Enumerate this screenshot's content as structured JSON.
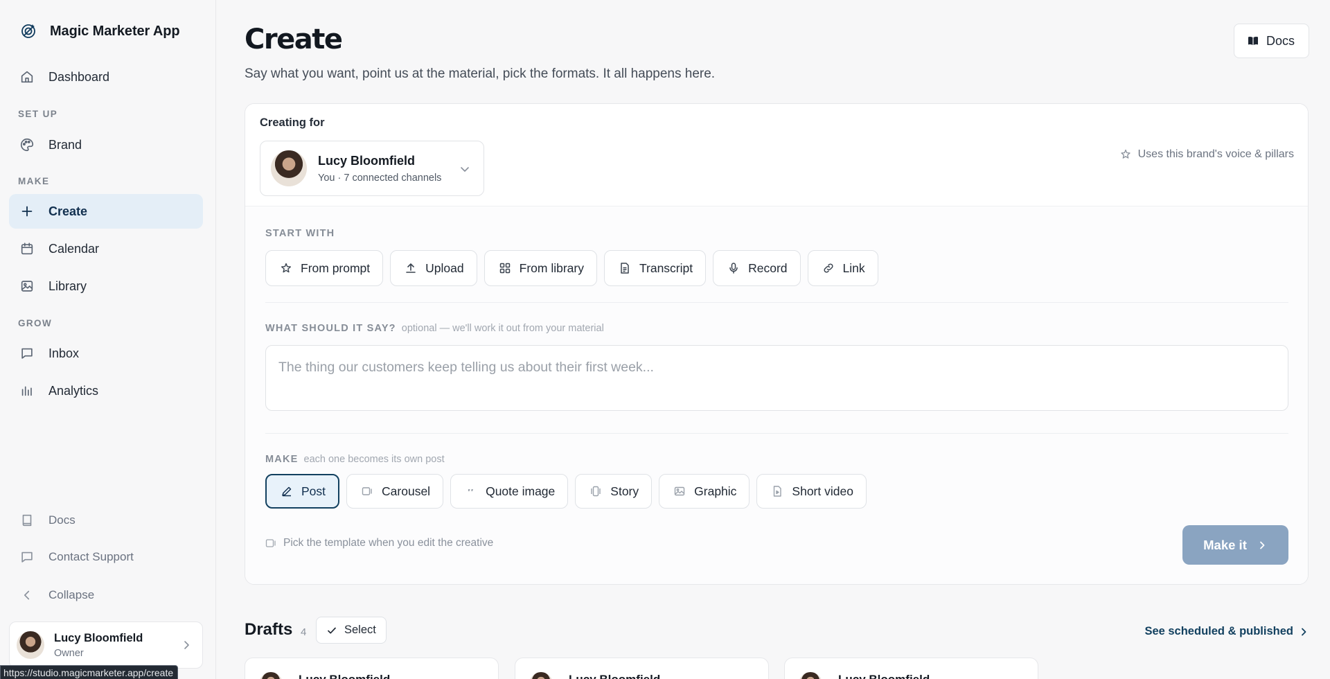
{
  "app": {
    "name": "Magic Marketer App",
    "logo_icon": "magic-wand-logo-icon"
  },
  "sidebar": {
    "top_items": [
      {
        "label": "Dashboard",
        "icon": "home-icon"
      }
    ],
    "sections": [
      {
        "label": "SET UP",
        "items": [
          {
            "label": "Brand",
            "icon": "palette-icon"
          }
        ]
      },
      {
        "label": "MAKE",
        "items": [
          {
            "label": "Create",
            "icon": "plus-icon",
            "active": true
          },
          {
            "label": "Calendar",
            "icon": "calendar-icon"
          },
          {
            "label": "Library",
            "icon": "image-icon"
          }
        ]
      },
      {
        "label": "GROW",
        "items": [
          {
            "label": "Inbox",
            "icon": "message-icon"
          },
          {
            "label": "Analytics",
            "icon": "bar-chart-icon"
          }
        ]
      }
    ],
    "bottom_items": [
      {
        "label": "Docs",
        "icon": "book-icon"
      },
      {
        "label": "Contact Support",
        "icon": "chat-icon"
      },
      {
        "label": "Collapse",
        "icon": "chevron-left-icon"
      }
    ],
    "user": {
      "name": "Lucy Bloomfield",
      "role": "Owner"
    }
  },
  "status_url": "https://studio.magicmarketer.app/create",
  "header": {
    "title": "Create",
    "subtitle": "Say what you want, point us at the material, pick the formats. It all happens here.",
    "docs_label": "Docs"
  },
  "create_card": {
    "creating_for_label": "Creating for",
    "brand": {
      "name": "Lucy Bloomfield",
      "meta": "You · 7 connected channels"
    },
    "voice_note": "Uses this brand's voice & pillars",
    "start_with": {
      "label": "START WITH",
      "options": [
        {
          "label": "From prompt",
          "icon": "sparkle-icon"
        },
        {
          "label": "Upload",
          "icon": "upload-icon"
        },
        {
          "label": "From library",
          "icon": "grid-icon"
        },
        {
          "label": "Transcript",
          "icon": "document-icon"
        },
        {
          "label": "Record",
          "icon": "microphone-icon"
        },
        {
          "label": "Link",
          "icon": "link-icon"
        }
      ]
    },
    "prompt": {
      "label": "WHAT SHOULD IT SAY?",
      "hint": "optional — we'll work it out from your material",
      "placeholder": "The thing our customers keep telling us about their first week..."
    },
    "make": {
      "label": "MAKE",
      "hint": "each one becomes its own post",
      "formats": [
        {
          "label": "Post",
          "icon": "pen-icon",
          "selected": true
        },
        {
          "label": "Carousel",
          "icon": "carousel-icon"
        },
        {
          "label": "Quote image",
          "icon": "quote-icon"
        },
        {
          "label": "Story",
          "icon": "story-icon"
        },
        {
          "label": "Graphic",
          "icon": "image-icon"
        },
        {
          "label": "Short video",
          "icon": "video-file-icon"
        }
      ]
    },
    "template_note": "Pick the template when you edit the creative",
    "make_button": "Make it"
  },
  "drafts": {
    "title": "Drafts",
    "count": "4",
    "select_label": "Select",
    "see_link": "See scheduled & published",
    "cards": [
      {
        "name": "Lucy Bloomfield"
      },
      {
        "name": "Lucy Bloomfield"
      },
      {
        "name": "Lucy Bloomfield"
      }
    ]
  }
}
